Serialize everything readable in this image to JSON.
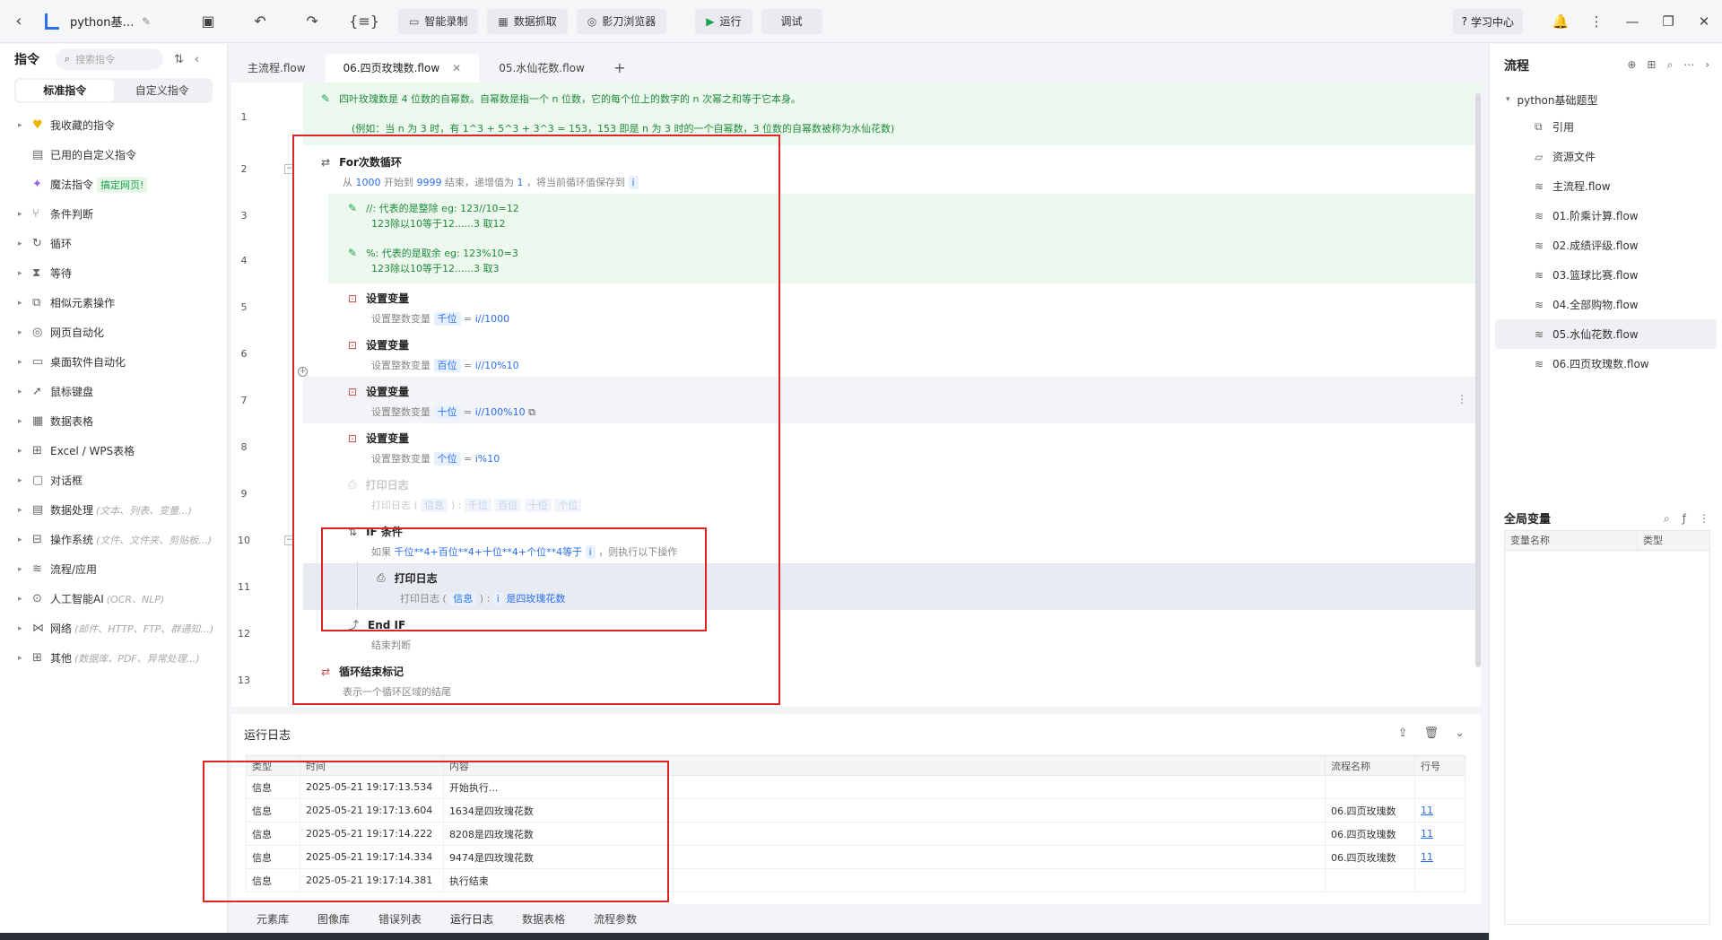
{
  "topbar": {
    "title": "python基…",
    "buttons": {
      "record": "智能录制",
      "extract": "数据抓取",
      "browser": "影刀浏览器",
      "run": "运行",
      "debug": "调试"
    },
    "learn": "学习中心"
  },
  "left": {
    "title": "指令",
    "search_placeholder": "搜索指令",
    "tabs": [
      "标准指令",
      "自定义指令"
    ],
    "items": [
      {
        "label": "我收藏的指令",
        "sub": "",
        "tag": ""
      },
      {
        "label": "已用的自定义指令",
        "sub": "",
        "tag": ""
      },
      {
        "label": "魔法指令",
        "sub": "",
        "tag": "搞定网页!"
      },
      {
        "label": "条件判断",
        "sub": "",
        "tag": ""
      },
      {
        "label": "循环",
        "sub": "",
        "tag": ""
      },
      {
        "label": "等待",
        "sub": "",
        "tag": ""
      },
      {
        "label": "相似元素操作",
        "sub": "",
        "tag": ""
      },
      {
        "label": "网页自动化",
        "sub": "",
        "tag": ""
      },
      {
        "label": "桌面软件自动化",
        "sub": "",
        "tag": ""
      },
      {
        "label": "鼠标键盘",
        "sub": "",
        "tag": ""
      },
      {
        "label": "数据表格",
        "sub": "",
        "tag": ""
      },
      {
        "label": "Excel / WPS表格",
        "sub": "",
        "tag": ""
      },
      {
        "label": "对话框",
        "sub": "",
        "tag": ""
      },
      {
        "label": "数据处理",
        "sub": "(文本、列表、变量...)",
        "tag": ""
      },
      {
        "label": "操作系统",
        "sub": "(文件、文件夹、剪贴板...)",
        "tag": ""
      },
      {
        "label": "流程/应用",
        "sub": "",
        "tag": ""
      },
      {
        "label": "人工智能AI",
        "sub": "(OCR、NLP)",
        "tag": ""
      },
      {
        "label": "网络",
        "sub": "(邮件、HTTP、FTP、群通知...)",
        "tag": ""
      },
      {
        "label": "其他",
        "sub": "(数据库、PDF、异常处理...)",
        "tag": ""
      }
    ]
  },
  "tabs": [
    "主流程.flow",
    "06.四页玫瑰数.flow",
    "05.水仙花数.flow"
  ],
  "editor": {
    "line_numbers": [
      "1",
      "2",
      "3",
      "4",
      "5",
      "6",
      "7",
      "8",
      "9",
      "10",
      "11",
      "12",
      "13"
    ],
    "comment1_line1": "四叶玫瑰数是 4 位数的自幂数。自幂数是指一个 n 位数，它的每个位上的数字的 n 次幂之和等于它本身。",
    "comment1_line2": "(例如：当 n 为 3 时，有 1^3 + 5^3 + 3^3 = 153，153 即是 n 为 3 时的一个自幂数，3 位数的自幂数被称为水仙花数)",
    "for": {
      "title": "For次数循环",
      "p1": "从",
      "start": "1000",
      "p2": "开始到",
      "end": "9999",
      "p3": "结束，递增值为",
      "step": "1",
      "p4": "，将当前循环值保存到",
      "var": "i"
    },
    "comment3_line1": "//: 代表的是整除  eg: 123//10=12",
    "comment3_line2": "123除以10等于12......3  取12",
    "comment4_line1": "%: 代表的是取余  eg: 123%10=3",
    "comment4_line2": "123除以10等于12......3  取3",
    "setvar_title": "设置变量",
    "setvar_desc": "设置整数变量",
    "eq": "=",
    "vars": [
      {
        "name": "千位",
        "expr": "i//1000"
      },
      {
        "name": "百位",
        "expr": "i//10%10"
      },
      {
        "name": "十位",
        "expr": "i//100%10"
      },
      {
        "name": "个位",
        "expr": "i%10"
      }
    ],
    "print_title": "打印日志",
    "print_desc": "打印日志 (",
    "print_level": "信息",
    "print_close": ") :",
    "print9_vars": [
      "千位",
      "百位",
      "十位",
      "个位"
    ],
    "if": {
      "title": "IF 条件",
      "p1": "如果",
      "cond": "千位**4+百位**4+十位**4+个位**4等于",
      "var": "i",
      "p2": "，则执行以下操作"
    },
    "print11_msg": "是四玫瑰花数",
    "endif": {
      "title": "End IF",
      "desc": "结束判断"
    },
    "endloop": {
      "title": "循环结束标记",
      "desc": "表示一个循环区域的结尾"
    }
  },
  "log": {
    "title": "运行日志",
    "headers": [
      "类型",
      "时间",
      "内容",
      "流程名称",
      "行号"
    ],
    "rows": [
      [
        "信息",
        "2025-05-21 19:17:13.534",
        "开始执行...",
        "",
        ""
      ],
      [
        "信息",
        "2025-05-21 19:17:13.604",
        "1634是四玫瑰花数",
        "06.四页玫瑰数",
        "11"
      ],
      [
        "信息",
        "2025-05-21 19:17:14.222",
        "8208是四玫瑰花数",
        "06.四页玫瑰数",
        "11"
      ],
      [
        "信息",
        "2025-05-21 19:17:14.334",
        "9474是四玫瑰花数",
        "06.四页玫瑰数",
        "11"
      ],
      [
        "信息",
        "2025-05-21 19:17:14.381",
        "执行结束",
        "",
        ""
      ]
    ]
  },
  "bottom_tabs": [
    "元素库",
    "图像库",
    "错误列表",
    "运行日志",
    "数据表格",
    "流程参数"
  ],
  "right": {
    "title": "流程",
    "root": "python基础题型",
    "items": [
      "引用",
      "资源文件",
      "主流程.flow",
      "01.阶乘计算.flow",
      "02.成绩评级.flow",
      "03.篮球比赛.flow",
      "04.全部购物.flow",
      "05.水仙花数.flow",
      "06.四页玫瑰数.flow"
    ],
    "gv_title": "全局变量",
    "gv_headers": [
      "变量名称",
      "类型"
    ]
  }
}
